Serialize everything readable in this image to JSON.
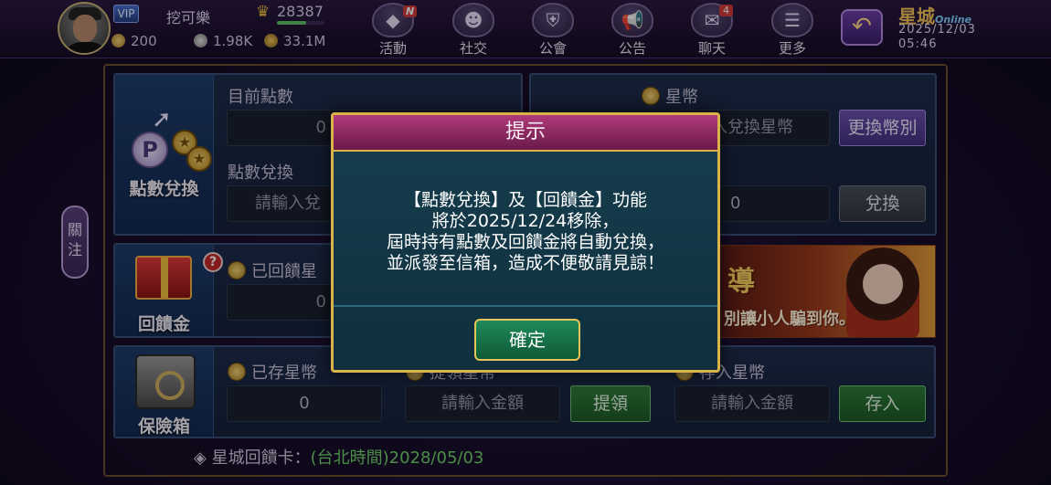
{
  "header": {
    "vip_label": "VIP",
    "username": "挖可樂",
    "crown_value": "28387",
    "xp_fraction": 0.62,
    "stats": [
      "200",
      "1.98K",
      "33.1M"
    ],
    "nav": [
      {
        "label": "活動",
        "icon": "diamond-icon",
        "badge": "N"
      },
      {
        "label": "社交",
        "icon": "people-icon",
        "badge": ""
      },
      {
        "label": "公會",
        "icon": "guild-shield-icon",
        "badge": ""
      },
      {
        "label": "公告",
        "icon": "megaphone-icon",
        "badge": ""
      },
      {
        "label": "聊天",
        "icon": "chat-bubble-icon",
        "badge": "4"
      },
      {
        "label": "更多",
        "icon": "menu-icon",
        "badge": ""
      }
    ],
    "logo_main": "星城",
    "logo_sub": "Online",
    "date": "2025/12/03",
    "time": "05:46"
  },
  "side_tab": "關注",
  "points": {
    "tile_label": "點數兌換",
    "current_caption": "目前點數",
    "current_value": "0",
    "exchange_caption": "點數兌換",
    "exchange_placeholder": "請輸入兌"
  },
  "coins": {
    "caption": "星幣",
    "exchange_placeholder": "入兌換星幣",
    "change_button": "更換幣別",
    "value": "0",
    "exchange_button": "兌換"
  },
  "rebate": {
    "tile_label": "回饋金",
    "caption": "已回饋星",
    "value": "0"
  },
  "banner": {
    "text1": "導",
    "text2": "別讓小人騙到你。"
  },
  "safe": {
    "tile_label": "保險箱",
    "stored_caption": "已存星幣",
    "stored_value": "0",
    "withdraw_caption": "提領星幣",
    "withdraw_placeholder": "請輸入金額",
    "withdraw_button": "提領",
    "deposit_caption": "存入星幣",
    "deposit_placeholder": "請輸入金額",
    "deposit_button": "存入"
  },
  "footer": {
    "label": "◈ 星城回饋卡：",
    "value": "(台北時間)2028/05/03"
  },
  "modal": {
    "title": "提示",
    "lines": [
      "【點數兌換】及【回饋金】功能",
      "將於2025/12/24移除，",
      "屆時持有點數及回饋金將自動兌換，",
      "並派發至信箱，造成不便敬請見諒！"
    ],
    "confirm": "確定"
  },
  "colors": {
    "modal_header": "#b03a7a",
    "modal_border": "#d9b24a",
    "confirm_button": "#1f8a5a",
    "green_text": "#6fd26a"
  }
}
